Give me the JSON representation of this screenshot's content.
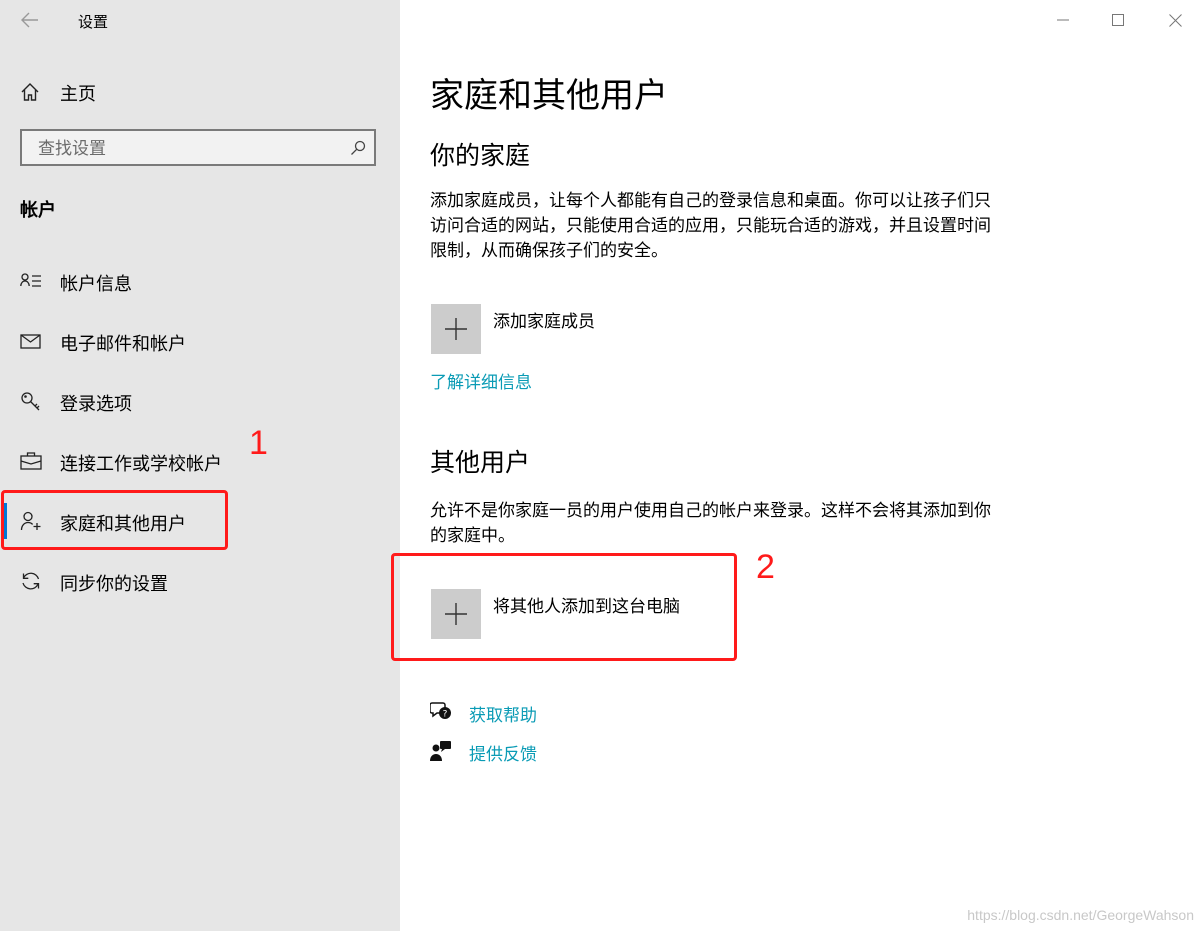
{
  "window": {
    "title": "设置",
    "controls": [
      "minimize-icon",
      "maximize-icon",
      "close-icon"
    ]
  },
  "sidebar": {
    "home_label": "主页",
    "search_placeholder": "查找设置",
    "section_title": "帐户",
    "items": [
      {
        "label": "帐户信息",
        "icon": "account-info-icon",
        "selected": false
      },
      {
        "label": "电子邮件和帐户",
        "icon": "mail-icon",
        "selected": false
      },
      {
        "label": "登录选项",
        "icon": "key-icon",
        "selected": false
      },
      {
        "label": "连接工作或学校帐户",
        "icon": "briefcase-icon",
        "selected": false
      },
      {
        "label": "家庭和其他用户",
        "icon": "person-add-icon",
        "selected": true
      },
      {
        "label": "同步你的设置",
        "icon": "sync-icon",
        "selected": false
      }
    ]
  },
  "main": {
    "page_title": "家庭和其他用户",
    "family": {
      "heading": "你的家庭",
      "description": "添加家庭成员，让每个人都能有自己的登录信息和桌面。你可以让孩子们只访问合适的网站，只能使用合适的应用，只能玩合适的游戏，并且设置时间限制，从而确保孩子们的安全。",
      "add_label": "添加家庭成员",
      "learn_more": "了解详细信息"
    },
    "others": {
      "heading": "其他用户",
      "description": "允许不是你家庭一员的用户使用自己的帐户来登录。这样不会将其添加到你的家庭中。",
      "add_label": "将其他人添加到这台电脑"
    },
    "help_links": [
      {
        "label": "获取帮助",
        "icon": "help-chat-icon"
      },
      {
        "label": "提供反馈",
        "icon": "feedback-icon"
      }
    ]
  },
  "annotations": {
    "one": "1",
    "two": "2"
  },
  "watermark": "https://blog.csdn.net/GeorgeWahson",
  "colors": {
    "accent": "#0078d7",
    "link": "#0a9bb5",
    "annotation": "#ff1a1a",
    "sidebar_bg": "#e6e6e6",
    "tile_bg": "#cccccc"
  }
}
